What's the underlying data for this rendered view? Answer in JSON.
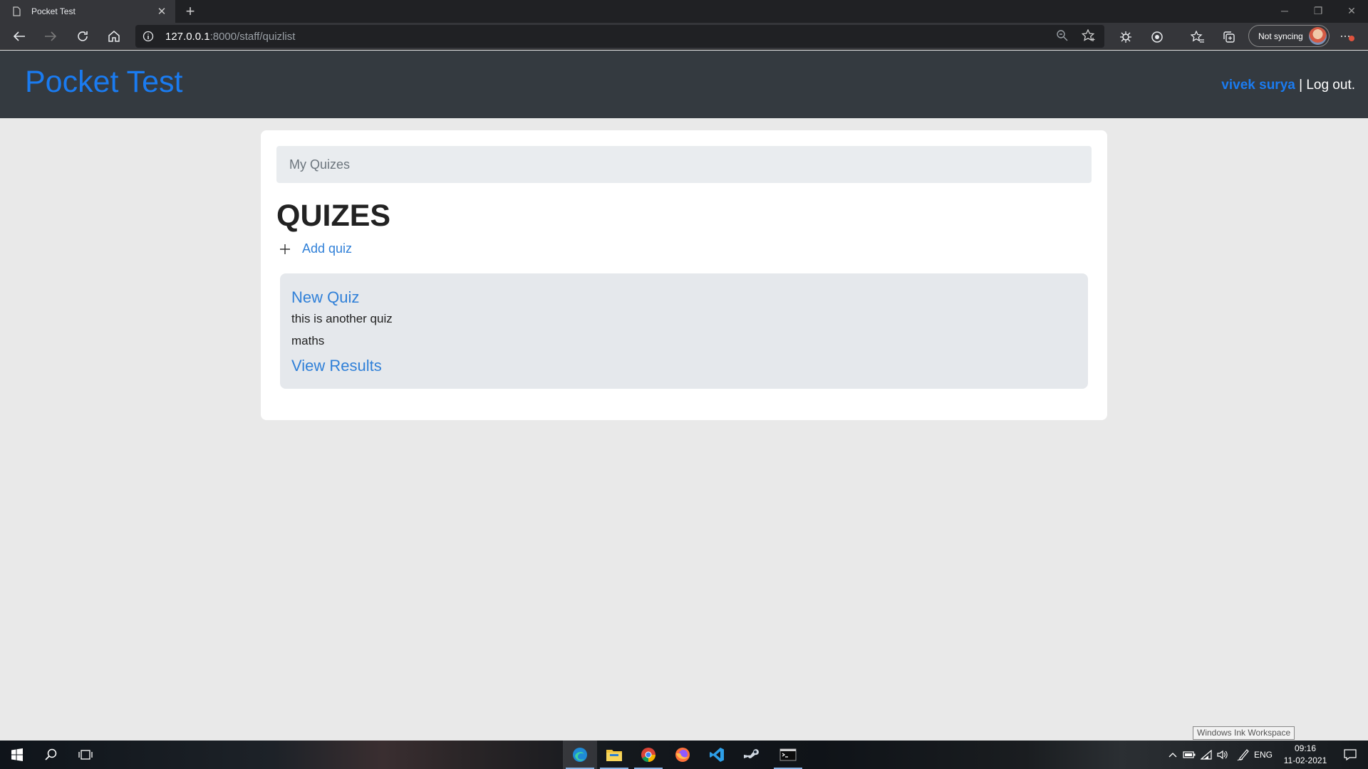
{
  "browser": {
    "tab_title": "Pocket Test",
    "url_host": "127.0.0.1",
    "url_path": ":8000/staff/quizlist",
    "sync_label": "Not syncing"
  },
  "site": {
    "brand": "Pocket Test",
    "username": "vivek surya",
    "separator": " | ",
    "logout_label": "Log out."
  },
  "main": {
    "breadcrumb": "My Quizes",
    "heading": "QUIZES",
    "add_quiz_label": "Add quiz",
    "quizzes": [
      {
        "title": "New Quiz",
        "description": "this is another quiz",
        "subject": "maths",
        "results_label": "View Results"
      }
    ]
  },
  "tooltip": "Windows Ink Workspace",
  "taskbar": {
    "language": "ENG",
    "time": "09:16",
    "date": "11-02-2021",
    "apps": [
      "edge-icon",
      "file-explorer-icon",
      "chrome-icon",
      "firefox-icon",
      "vscode-icon",
      "steam-icon",
      "terminal-icon"
    ]
  },
  "colors": {
    "brand": "#1a7bf0",
    "link": "#3080d8",
    "header_bg": "#343a40",
    "page_bg": "#e9e9e9",
    "quiz_bg": "#e5e8ec"
  }
}
